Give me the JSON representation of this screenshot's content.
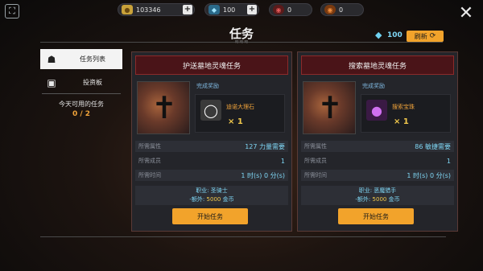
{
  "top_bar": {
    "gold": {
      "icon": "gold-coin-icon",
      "value": "103346"
    },
    "crystal": {
      "icon": "crystal-icon",
      "value": "100"
    },
    "token_red": {
      "icon": "red-token-icon",
      "value": "0"
    },
    "token_orange": {
      "icon": "orange-token-icon",
      "value": "0"
    },
    "plus": "+"
  },
  "header": {
    "title": "任务",
    "diamonds": "100",
    "refresh_label": "刷新"
  },
  "sidebar": {
    "tabs": [
      {
        "label": "任务列表",
        "icon": "quest-list-icon",
        "active": true
      },
      {
        "label": "投资板",
        "icon": "investment-board-icon",
        "active": false
      }
    ],
    "available_label": "今天可用的任务",
    "available_count": "0 / 2"
  },
  "quests": [
    {
      "title": "护送墓地灵魂任务",
      "reward_label": "完成奖励",
      "item_name": "迪诺大理石",
      "item_qty": "× 1",
      "item_color": "#1c1c1c",
      "req_attr_label": "所需属性",
      "req_attr_value": "127 力量需要",
      "req_members_label": "所需成员",
      "req_members_value": "1",
      "req_time_label": "所需时间",
      "req_time_value": "1 时(s) 0 分(s)",
      "job": "职业: 圣骑士",
      "bonus_prefix": "-额外:",
      "bonus_value": "5000",
      "bonus_unit": "金币",
      "start_label": "开始任务"
    },
    {
      "title": "搜索墓地灵魂任务",
      "reward_label": "完成奖励",
      "item_name": "搜索宝珠",
      "item_qty": "× 1",
      "item_color": "#6a1a7a",
      "req_attr_label": "所需属性",
      "req_attr_value": "86 敏捷需要",
      "req_members_label": "所需成员",
      "req_members_value": "1",
      "req_time_label": "所需时间",
      "req_time_value": "1 时(s) 0 分(s)",
      "job": "职业: 恶魔猎手",
      "bonus_prefix": "-额外:",
      "bonus_value": "5000",
      "bonus_unit": "金币",
      "start_label": "开始任务"
    }
  ]
}
